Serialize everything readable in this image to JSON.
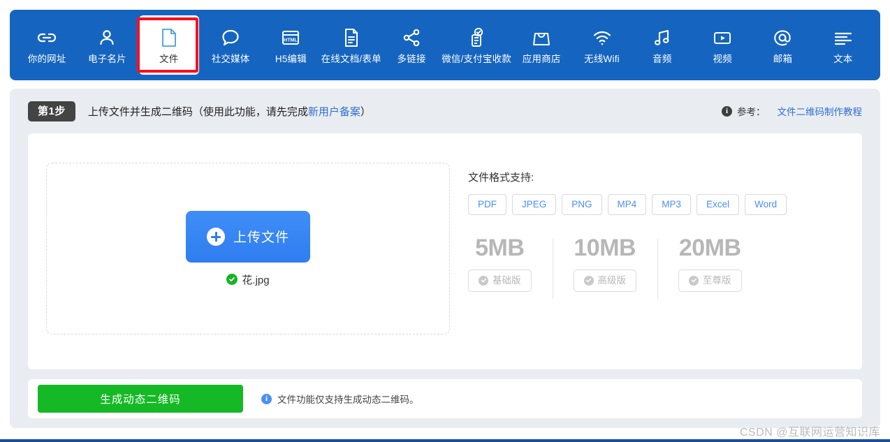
{
  "nav": {
    "items": [
      {
        "label": "你的网址",
        "icon": "link-icon",
        "active": false
      },
      {
        "label": "电子名片",
        "icon": "person-icon",
        "active": false
      },
      {
        "label": "文件",
        "icon": "file-icon",
        "active": true
      },
      {
        "label": "社交媒体",
        "icon": "chat-bubble-icon",
        "active": false
      },
      {
        "label": "H5编辑",
        "icon": "html-page-icon",
        "active": false
      },
      {
        "label": "在线文档/表单",
        "icon": "document-lines-icon",
        "active": false
      },
      {
        "label": "多链接",
        "icon": "share-nodes-icon",
        "active": false
      },
      {
        "label": "微信/支付宝收款",
        "icon": "payment-check-icon",
        "active": false
      },
      {
        "label": "应用商店",
        "icon": "shopping-bag-icon",
        "active": false
      },
      {
        "label": "无线Wifi",
        "icon": "wifi-icon",
        "active": false
      },
      {
        "label": "音频",
        "icon": "music-note-icon",
        "active": false
      },
      {
        "label": "视频",
        "icon": "video-play-icon",
        "active": false
      },
      {
        "label": "邮箱",
        "icon": "at-sign-icon",
        "active": false
      },
      {
        "label": "文本",
        "icon": "text-lines-icon",
        "active": false
      }
    ]
  },
  "step": {
    "badge": "第1步",
    "title_before": "上传文件并生成二维码（使用此功能，请先完成",
    "title_link": "新用户备案",
    "title_after": "）",
    "ref_info_glyph": "i",
    "ref_label": "参考：",
    "ref_link": "文件二维码制作教程"
  },
  "upload": {
    "button_label": "上传文件",
    "file_name": "花.jpg"
  },
  "formats": {
    "title": "文件格式支持:",
    "chips": [
      "PDF",
      "JPEG",
      "PNG",
      "MP4",
      "MP3",
      "Excel",
      "Word"
    ]
  },
  "tiers": [
    {
      "size": "5MB",
      "plan": "基础版"
    },
    {
      "size": "10MB",
      "plan": "高级版"
    },
    {
      "size": "20MB",
      "plan": "至尊版"
    }
  ],
  "bottom": {
    "generate_label": "生成动态二维码",
    "note_glyph": "i",
    "note": "文件功能仅支持生成动态二维码。"
  },
  "watermark": "CSDN @互联网运营知识库",
  "colors": {
    "nav_blue": "#1565c0",
    "accent_blue": "#2f7df0",
    "link_blue": "#2f6fd0",
    "green": "#15b925",
    "highlight_red": "#fc0d1c",
    "card_bg": "#e9edf1"
  }
}
